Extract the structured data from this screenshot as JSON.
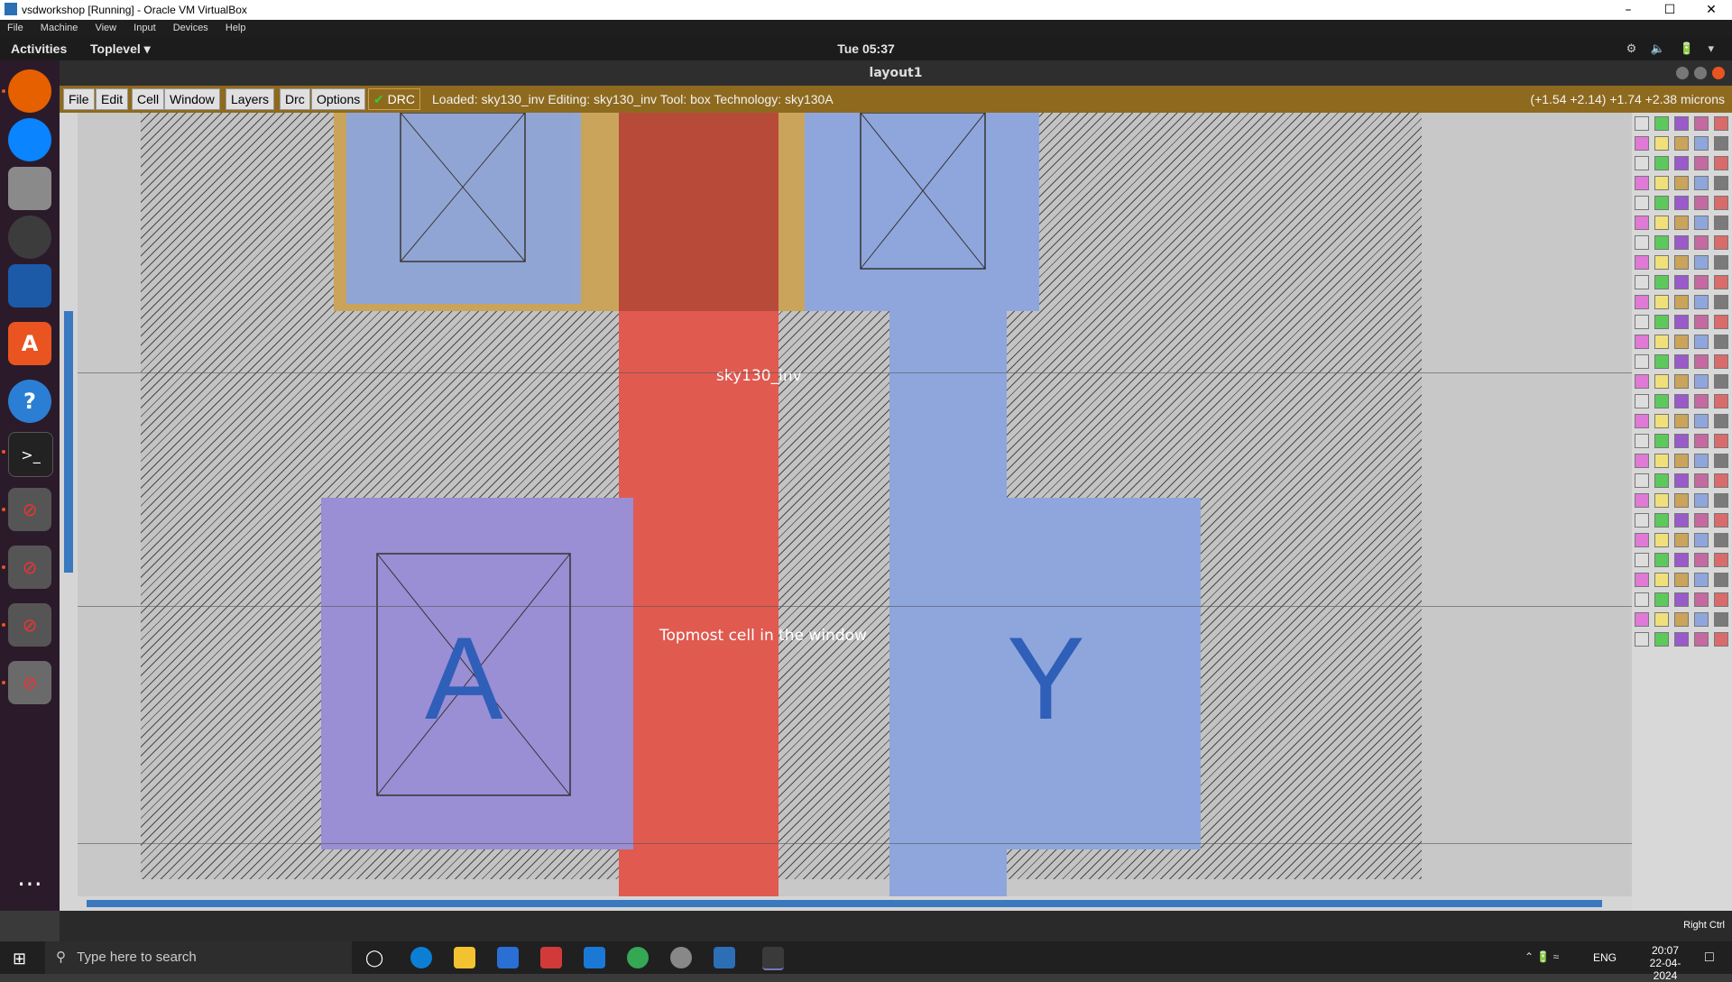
{
  "host_window": {
    "title": "vsdworkshop [Running] - Oracle VM VirtualBox",
    "menu": [
      "File",
      "Machine",
      "View",
      "Input",
      "Devices",
      "Help"
    ],
    "controls": [
      "minimize",
      "maximize",
      "close"
    ]
  },
  "gnome": {
    "activities": "Activities",
    "app_menu": "Toplevel",
    "clock": "Tue 05:37"
  },
  "dock": {
    "items": [
      "firefox-icon",
      "thunderbird-icon",
      "files-icon",
      "rhythmbox-icon",
      "writer-icon",
      "software-icon",
      "help-icon",
      "terminal-icon",
      "blocked-app-icon",
      "blocked-app-icon",
      "blocked-app-icon",
      "blocked-app-icon",
      "apps-grid-icon"
    ]
  },
  "magic": {
    "window_title": "layout1",
    "menu": [
      "File",
      "Edit",
      "Cell",
      "Window",
      "Layers",
      "Drc",
      "Options"
    ],
    "drc_label": "DRC",
    "status": "Loaded: sky130_inv Editing: sky130_inv Tool: box  Technology: sky130A",
    "coords": "(+1.54 +2.14) +1.74 +2.38 microns"
  },
  "layout": {
    "cell_label": "sky130_inv",
    "topmost_label": "Topmost cell in the window",
    "port_a": "A",
    "port_y": "Y",
    "colors": {
      "poly": "#e05a50",
      "locali": "#8fa6dc",
      "ndiff": "#c9a45a",
      "metal": "#9a8ed4"
    }
  },
  "vbox_status": {
    "host_key": "Right Ctrl"
  },
  "taskbar": {
    "search_placeholder": "Type here to search",
    "lang": "ENG",
    "time": "20:07",
    "date": "22-04-2024"
  }
}
